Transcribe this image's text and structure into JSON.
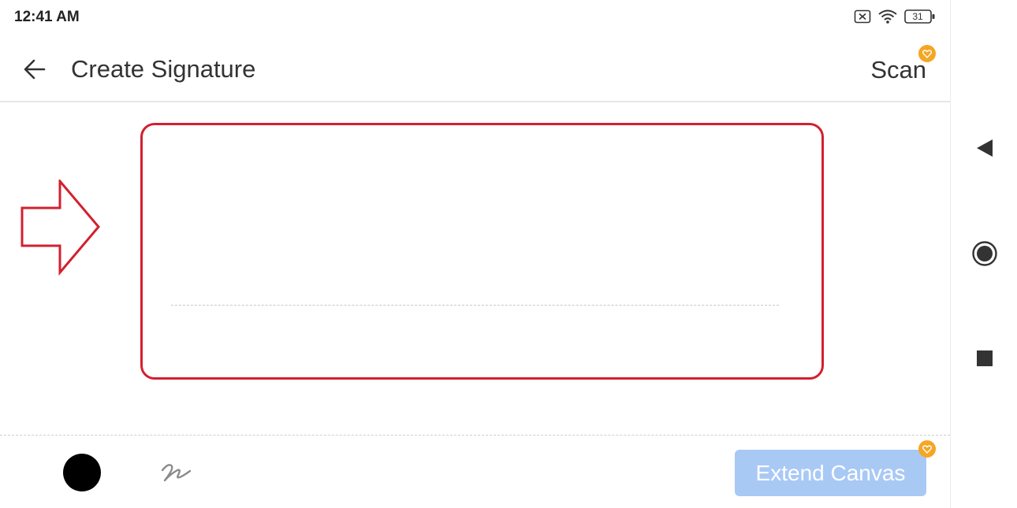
{
  "status_bar": {
    "time": "12:41 AM",
    "battery_level": "31",
    "icons": [
      "sim-off-icon",
      "wifi-icon",
      "battery-icon"
    ]
  },
  "toolbar": {
    "back_icon": "arrow-left-icon",
    "title": "Create Signature",
    "scan_label": "Scan",
    "scan_badge_icon": "premium-heart-icon"
  },
  "canvas": {
    "pointer_icon": "arrow-right-outline-icon"
  },
  "bottom_bar": {
    "pen_color": "#000000",
    "pen_icon": "pen-stroke-icon",
    "extend_label": "Extend Canvas",
    "extend_badge_icon": "premium-heart-icon"
  },
  "nav_bar": {
    "buttons": [
      "back-triangle-icon",
      "home-circle-icon",
      "recents-square-icon"
    ]
  },
  "colors": {
    "accent_red": "#d32030",
    "premium_badge": "#f5a623",
    "extend_button_bg": "#a9c9f5"
  }
}
